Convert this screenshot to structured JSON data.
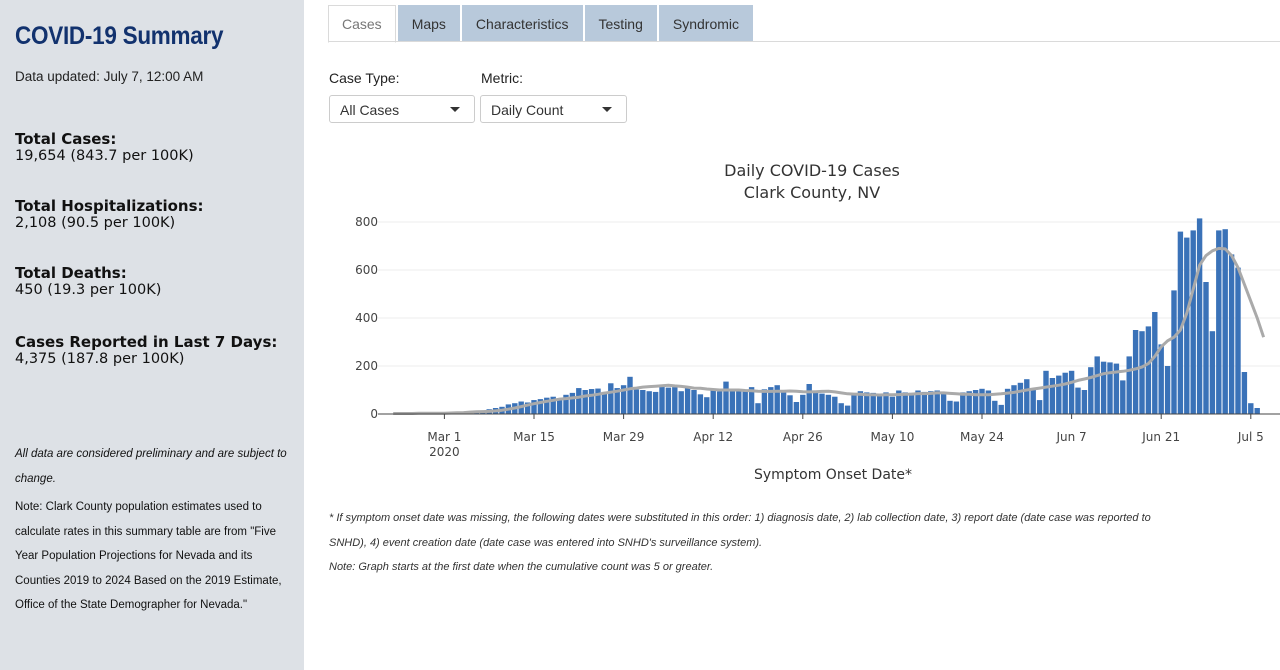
{
  "sidebar": {
    "title": "COVID-19 Summary",
    "updated": "Data updated: July 7, 12:00 AM",
    "stats": [
      {
        "label": "Total Cases:",
        "value": "19,654 (843.7 per 100K)"
      },
      {
        "label": "Total Hospitalizations:",
        "value": "2,108 (90.5 per 100K)"
      },
      {
        "label": "Total Deaths:",
        "value": "450 (19.3 per 100K)"
      },
      {
        "label": "Cases Reported in Last 7 Days:",
        "value": "4,375 (187.8 per 100K)"
      }
    ],
    "note_prelim": "All data are considered preliminary and are subject to change.",
    "note_population": "Note: Clark County population estimates used to calculate rates in this summary table are from \"Five Year Population Projections for Nevada and its Counties 2019 to 2024 Based on the 2019 Estimate, Office of the State Demographer for Nevada.\""
  },
  "tabs": [
    "Cases",
    "Maps",
    "Characteristics",
    "Testing",
    "Syndromic"
  ],
  "controls": {
    "case_type_label": "Case Type:",
    "case_type_value": "All Cases",
    "metric_label": "Metric:",
    "metric_value": "Daily Count"
  },
  "colors": {
    "bar": "#3a72b8",
    "avg_line": "#aaaaaa",
    "title": "#12326e",
    "tab_bg": "#b8c9db"
  },
  "chart_data": {
    "type": "bar",
    "title": "Daily COVID-19 Cases",
    "subtitle": "Clark County, NV",
    "xlabel": "Symptom Onset Date*",
    "ylabel": "",
    "ylim": [
      0,
      850
    ],
    "x_start": "2020-02-22",
    "yticks": [
      0,
      200,
      400,
      600,
      800
    ],
    "xticks": [
      {
        "label": "Mar 1",
        "sub": "2020",
        "day": 8
      },
      {
        "label": "Mar 15",
        "sub": "",
        "day": 22
      },
      {
        "label": "Mar 29",
        "sub": "",
        "day": 36
      },
      {
        "label": "Apr 12",
        "sub": "",
        "day": 50
      },
      {
        "label": "Apr 26",
        "sub": "",
        "day": 64
      },
      {
        "label": "May 10",
        "sub": "",
        "day": 78
      },
      {
        "label": "May 24",
        "sub": "",
        "day": 92
      },
      {
        "label": "Jun 7",
        "sub": "",
        "day": 106
      },
      {
        "label": "Jun 21",
        "sub": "",
        "day": 120
      },
      {
        "label": "Jul 5",
        "sub": "",
        "day": 134
      }
    ],
    "series": [
      {
        "name": "Daily Count",
        "values": [
          2,
          2,
          3,
          4,
          3,
          2,
          3,
          5,
          6,
          8,
          8,
          10,
          12,
          14,
          14,
          20,
          25,
          30,
          40,
          45,
          52,
          48,
          58,
          62,
          68,
          72,
          65,
          80,
          88,
          108,
          100,
          104,
          106,
          92,
          128,
          108,
          120,
          155,
          102,
          100,
          95,
          92,
          115,
          110,
          112,
          95,
          112,
          100,
          82,
          70,
          105,
          94,
          135,
          95,
          98,
          94,
          112,
          45,
          103,
          112,
          120,
          98,
          78,
          50,
          80,
          125,
          88,
          85,
          80,
          72,
          45,
          35,
          85,
          95,
          90,
          88,
          85,
          90,
          72,
          98,
          90,
          88,
          98,
          92,
          95,
          98,
          88,
          55,
          52,
          90,
          95,
          100,
          105,
          98,
          55,
          38,
          105,
          120,
          130,
          145,
          100,
          58,
          180,
          150,
          160,
          172,
          180,
          110,
          100,
          195,
          240,
          218,
          215,
          210,
          140,
          240,
          350,
          345,
          365,
          425,
          290,
          200,
          515,
          760,
          735,
          765,
          815,
          550,
          345,
          765,
          770,
          665,
          610,
          175,
          45,
          25
        ]
      },
      {
        "name": "7-day average",
        "values": [
          2,
          2,
          2,
          2,
          3,
          3,
          3,
          3,
          3,
          4,
          5,
          6,
          8,
          9,
          10,
          11,
          13,
          16,
          20,
          25,
          31,
          37,
          43,
          48,
          53,
          57,
          62,
          64,
          67,
          70,
          75,
          78,
          82,
          87,
          91,
          95,
          100,
          105,
          108,
          112,
          114,
          116,
          118,
          120,
          117,
          115,
          112,
          108,
          107,
          104,
          102,
          100,
          100,
          100,
          100,
          98,
          97,
          95,
          94,
          94,
          95,
          95,
          96,
          95,
          93,
          92,
          93,
          94,
          95,
          92,
          88,
          84,
          83,
          82,
          80,
          80,
          79,
          80,
          80,
          81,
          82,
          83,
          85,
          85,
          86,
          88,
          88,
          86,
          84,
          82,
          82,
          80,
          80,
          80,
          82,
          84,
          87,
          90,
          95,
          100,
          104,
          108,
          112,
          116,
          120,
          125,
          132,
          140,
          146,
          152,
          160,
          168,
          172,
          175,
          178,
          182,
          188,
          196,
          210,
          240,
          280,
          305,
          320,
          350,
          420,
          520,
          620,
          660,
          680,
          690,
          688,
          660,
          610,
          540,
          470,
          400,
          320
        ]
      }
    ]
  },
  "footnotes": [
    "* If symptom onset date was missing, the following dates were substituted in this order: 1) diagnosis date, 2) lab collection date, 3) report date (date case was reported to",
    "SNHD), 4) event creation date (date case was entered into SNHD's surveillance system).",
    "Note: Graph starts at the first date when the cumulative count was 5 or greater."
  ]
}
